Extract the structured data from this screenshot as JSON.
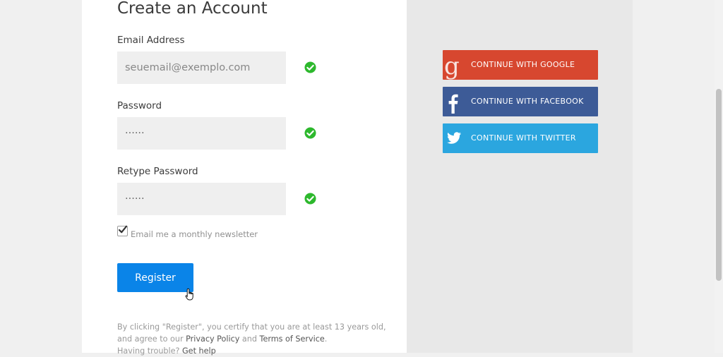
{
  "form": {
    "title": "Create an Account",
    "email_label": "Email Address",
    "email_placeholder": "seuemail@exemplo.com",
    "password_label": "Password",
    "password_value": "······",
    "retype_label": "Retype Password",
    "retype_value": "······",
    "newsletter_label": "Email me a monthly newsletter",
    "newsletter_checked": true,
    "register_label": "Register"
  },
  "terms": {
    "text_before": "By clicking \"Register\", you certify that you are at least 13 years old, and agree to our ",
    "privacy_link": "Privacy Policy",
    "and_text": " and ",
    "tos_link": "Terms of Service",
    "period": ".",
    "trouble_text": "Having trouble? ",
    "help_link": "Get help"
  },
  "social": {
    "google_label": "CONTINUE WITH GOOGLE",
    "facebook_label": "CONTINUE WITH FACEBOOK",
    "twitter_label": "CONTINUE WITH TWITTER"
  },
  "icons": {
    "valid": "check-circle-icon",
    "google": "google-icon",
    "facebook": "facebook-icon",
    "twitter": "twitter-icon"
  },
  "colors": {
    "primary": "#0a84e8",
    "valid": "#2db82d",
    "google": "#d7472f",
    "facebook": "#3d5b97",
    "twitter": "#2ba6df"
  }
}
